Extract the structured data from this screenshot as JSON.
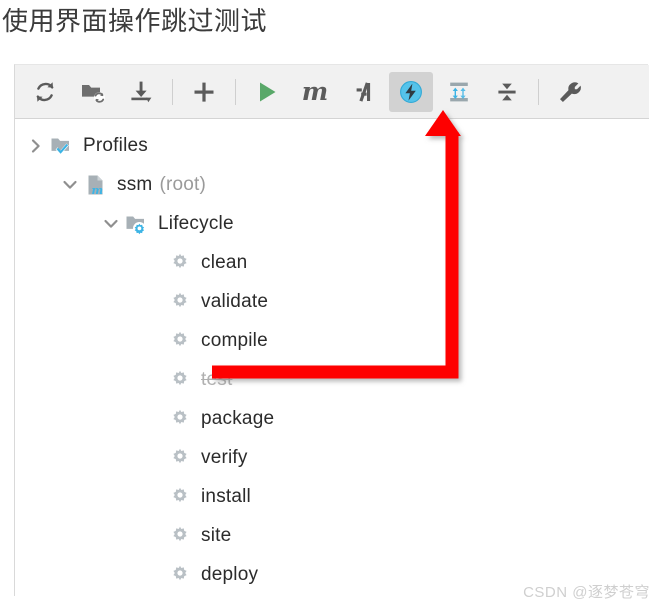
{
  "page": {
    "title": "使用界面操作跳过测试",
    "watermark": "CSDN @逐梦苍穹"
  },
  "colors": {
    "accent_blue": "#3cb4e5",
    "run_green": "#59a869",
    "annotation_red": "#fe0000",
    "toolbar_bg": "#f1f1f1",
    "selected_bg": "#d2d2d2",
    "icon_gray": "#6e6e6e",
    "gear_gray": "#b9c0c5",
    "text_dark": "#2b2b2b",
    "text_muted": "#9a9a9a",
    "text_skipped": "#b0b0b0"
  },
  "toolbar": {
    "buttons": [
      {
        "name": "reimport-icon",
        "label": "Reload All Maven Projects",
        "type": "icon",
        "selected": false
      },
      {
        "name": "generate-sources-icon",
        "label": "Generate Sources and Update Folders",
        "type": "icon",
        "selected": false
      },
      {
        "name": "download-sources-icon",
        "label": "Download Sources and/or Documentation",
        "type": "icon",
        "selected": false
      },
      {
        "name": "separator",
        "label": "",
        "type": "separator",
        "selected": false
      },
      {
        "name": "add-maven-project-icon",
        "label": "Add Maven Project",
        "type": "icon",
        "selected": false
      },
      {
        "name": "separator",
        "label": "",
        "type": "separator",
        "selected": false
      },
      {
        "name": "run-icon",
        "label": "Run",
        "type": "icon",
        "selected": false
      },
      {
        "name": "execute-maven-goal-icon",
        "label": "m",
        "type": "letter",
        "selected": false
      },
      {
        "name": "toggle-ignored-projects-icon",
        "label": "Toggle 'Skip Tests' Mode",
        "type": "icon",
        "selected": false
      },
      {
        "name": "skip-tests-icon",
        "label": "Skip Tests",
        "type": "icon",
        "selected": true
      },
      {
        "name": "expand-all-icon",
        "label": "Expand All",
        "type": "icon",
        "selected": false
      },
      {
        "name": "collapse-all-icon",
        "label": "Collapse All",
        "type": "icon",
        "selected": false
      },
      {
        "name": "separator",
        "label": "",
        "type": "separator",
        "selected": false
      },
      {
        "name": "settings-icon",
        "label": "Maven Settings",
        "type": "icon",
        "selected": false
      }
    ]
  },
  "tree": {
    "nodes": [
      {
        "label": "Profiles",
        "suffix": "",
        "icon": "folder-check-icon",
        "chevron": "collapsed",
        "indent": 1,
        "skipped": false
      },
      {
        "label": "ssm",
        "suffix": "(root)",
        "icon": "maven-project-icon",
        "chevron": "expanded",
        "indent": 2,
        "skipped": false
      },
      {
        "label": "Lifecycle",
        "suffix": "",
        "icon": "folder-gear-icon",
        "chevron": "expanded",
        "indent": 3,
        "skipped": false
      },
      {
        "label": "clean",
        "suffix": "",
        "icon": "gear-icon",
        "chevron": "none",
        "indent": 4,
        "skipped": false
      },
      {
        "label": "validate",
        "suffix": "",
        "icon": "gear-icon",
        "chevron": "none",
        "indent": 4,
        "skipped": false
      },
      {
        "label": "compile",
        "suffix": "",
        "icon": "gear-icon",
        "chevron": "none",
        "indent": 4,
        "skipped": false
      },
      {
        "label": "test",
        "suffix": "",
        "icon": "gear-icon",
        "chevron": "none",
        "indent": 4,
        "skipped": true
      },
      {
        "label": "package",
        "suffix": "",
        "icon": "gear-icon",
        "chevron": "none",
        "indent": 4,
        "skipped": false
      },
      {
        "label": "verify",
        "suffix": "",
        "icon": "gear-icon",
        "chevron": "none",
        "indent": 4,
        "skipped": false
      },
      {
        "label": "install",
        "suffix": "",
        "icon": "gear-icon",
        "chevron": "none",
        "indent": 4,
        "skipped": false
      },
      {
        "label": "site",
        "suffix": "",
        "icon": "gear-icon",
        "chevron": "none",
        "indent": 4,
        "skipped": false
      },
      {
        "label": "deploy",
        "suffix": "",
        "icon": "gear-icon",
        "chevron": "none",
        "indent": 4,
        "skipped": false
      }
    ]
  },
  "annotation": {
    "description": "red arrow from skipped test goal up to the Skip Tests toolbar button",
    "color": "#fe0000"
  }
}
